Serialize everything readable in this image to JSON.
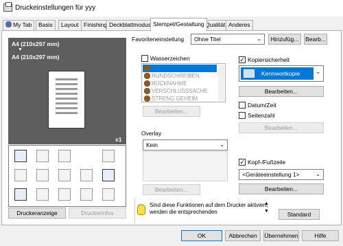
{
  "window": {
    "title": "Druckeinstellungen für yyy"
  },
  "tabs": [
    "My Tab",
    "Basis",
    "Layout",
    "Finishing",
    "Deckblattmodus",
    "Stempel/Gestaltung",
    "Qualität",
    "Anderes"
  ],
  "preview": {
    "paper_top": "A4 (210x297 mm)",
    "arrow": "▼",
    "paper_bottom": "A4 (210x297 mm)",
    "copies": "x1"
  },
  "left_buttons": {
    "printer_view": "Druckeranzeige",
    "printer_info": "Druckerinfos"
  },
  "favorites": {
    "label": "Favoriteneinstellung",
    "value": "Ohne Titel",
    "add": "Hinzufüg...",
    "edit": "Bearb..."
  },
  "watermark": {
    "label": "Wasserzeichen",
    "checked": false,
    "items": [
      "",
      "RUNDSCHREIBEN",
      "RÜCKNAHME",
      "VERSCHLUSSSACHE",
      "STRENG GEHEIM"
    ],
    "edit": "Bearbeiten..."
  },
  "overlay": {
    "label": "Overlay",
    "value": "Kein",
    "edit": "Bearbeiten..."
  },
  "copy_security": {
    "label": "Kopiersicherheit",
    "checked": true,
    "value": "Kennwortkopie",
    "edit": "Bearbeiten..."
  },
  "date_time": {
    "label": "Datum/Zeit",
    "checked": false
  },
  "page_number": {
    "label": "Seitenzahl",
    "checked": false,
    "edit": "Bearbeiten..."
  },
  "header_footer": {
    "label": "Kopf-/Fußzeile",
    "checked": true,
    "value": "<Geräteeinstellung 1>",
    "edit": "Bearbeiten..."
  },
  "info": {
    "line1": "Sind diese Funktionen auf dem Drucker aktiviert,",
    "line2": "werden die entsprechenden",
    "standard": "Standard"
  },
  "footer": {
    "ok": "OK",
    "cancel": "Abbrechen",
    "apply": "Übernehmen",
    "help": "Hilfe"
  },
  "colors": {
    "selection": "#0078d7",
    "preview_bg": "#5e5e5e"
  }
}
